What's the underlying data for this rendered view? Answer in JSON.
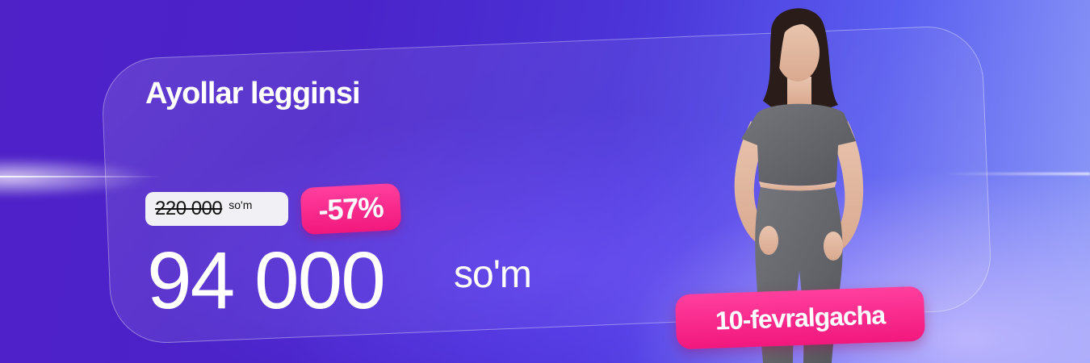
{
  "product": {
    "title": "Ayollar legginsi",
    "old_price": "220 000",
    "old_currency": "so'm",
    "discount": "-57%",
    "price": "94 000",
    "currency": "so'm",
    "deadline": "10-fevralgacha"
  },
  "colors": {
    "accent_pink": "#f2187d",
    "background_violet": "#4f22c8",
    "text": "#ffffff"
  }
}
